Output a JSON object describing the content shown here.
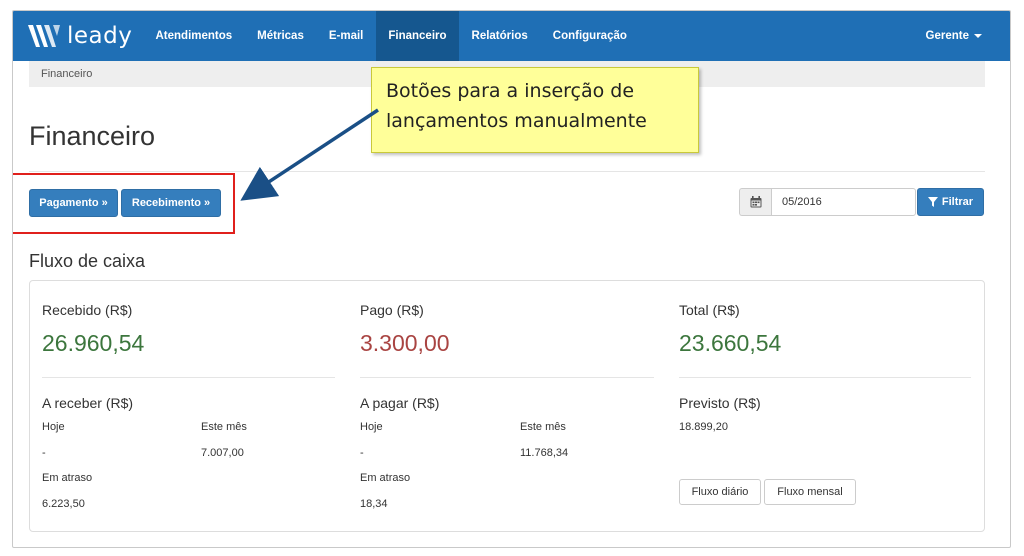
{
  "app": {
    "logo_text": "leady"
  },
  "nav": {
    "items": [
      {
        "label": "Atendimentos"
      },
      {
        "label": "Métricas"
      },
      {
        "label": "E-mail"
      },
      {
        "label": "Financeiro",
        "active": true
      },
      {
        "label": "Relatórios"
      },
      {
        "label": "Configuração"
      }
    ],
    "user_label": "Gerente"
  },
  "breadcrumb": "Financeiro",
  "page": {
    "title": "Financeiro"
  },
  "actions": {
    "pagamento_label": "Pagamento »",
    "recebimento_label": "Recebimento »"
  },
  "filter": {
    "date_value": "05/2016",
    "filter_label": "Filtrar",
    "calendar_icon": "calendar-icon",
    "filter_icon": "funnel-icon"
  },
  "cashflow": {
    "title": "Fluxo de caixa",
    "recebido": {
      "label": "Recebido (R$)",
      "value": "26.960,54"
    },
    "pago": {
      "label": "Pago (R$)",
      "value": "3.300,00"
    },
    "total": {
      "label": "Total (R$)",
      "value": "23.660,54"
    },
    "a_receber": {
      "label": "A receber (R$)",
      "hoje_label": "Hoje",
      "hoje_value": "-",
      "mes_label": "Este mês",
      "mes_value": "7.007,00",
      "atraso_label": "Em atraso",
      "atraso_value": "6.223,50"
    },
    "a_pagar": {
      "label": "A pagar (R$)",
      "hoje_label": "Hoje",
      "hoje_value": "-",
      "mes_label": "Este mês",
      "mes_value": "11.768,34",
      "atraso_label": "Em atraso",
      "atraso_value": "18,34"
    },
    "previsto": {
      "label": "Previsto (R$)",
      "value": "18.899,20"
    },
    "buttons": {
      "diario_label": "Fluxo diário",
      "mensal_label": "Fluxo mensal"
    }
  },
  "annotation": {
    "callout_text": "Botões para a inserção de lançamentos manualmente"
  },
  "colors": {
    "navbar": "#1f6fb5",
    "nav_active": "#15578f",
    "primary_button": "#357ebd",
    "positive_value": "#3c763d",
    "negative_value": "#a94442",
    "callout_bg": "#ffff99",
    "highlight_border": "#e0201c",
    "arrow": "#1a4f86"
  }
}
